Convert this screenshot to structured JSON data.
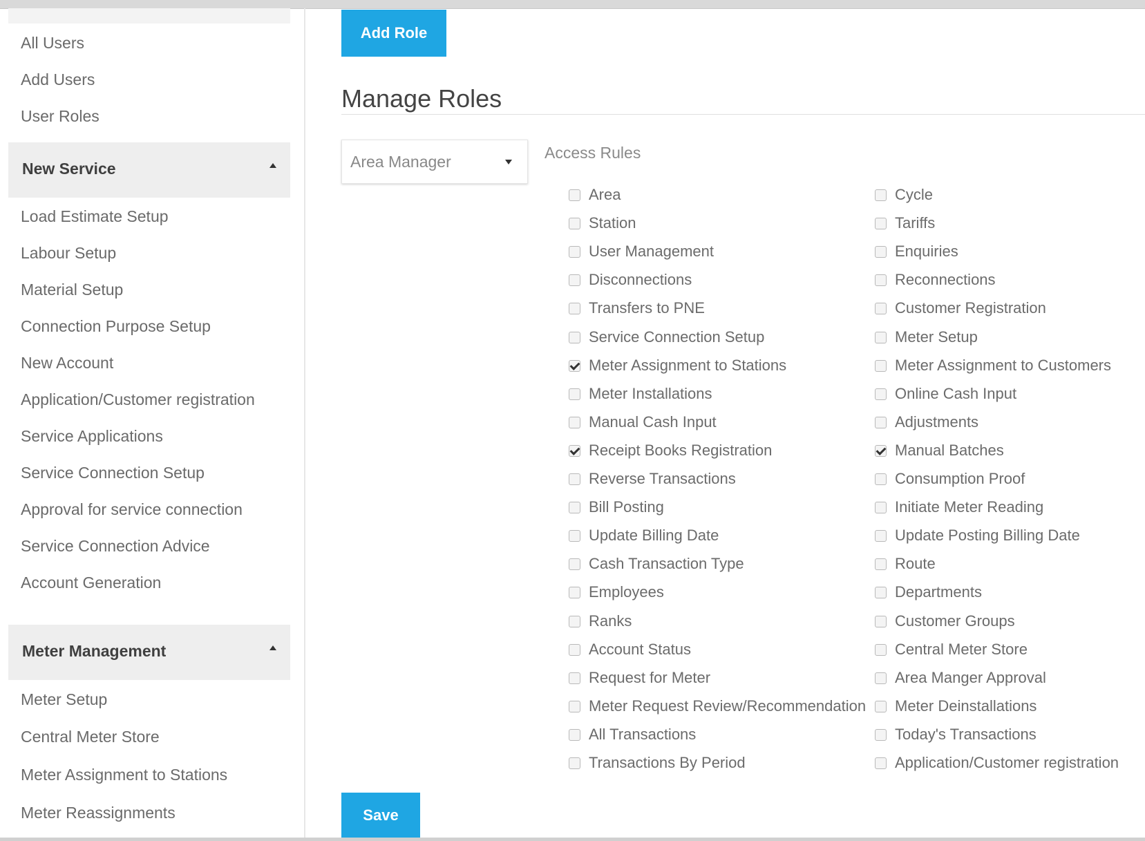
{
  "sidebar": {
    "top_items": [
      "All Users",
      "Add Users",
      "User Roles"
    ],
    "sections": [
      {
        "title": "New Service",
        "items": [
          "Load Estimate Setup",
          "Labour Setup",
          "Material Setup",
          "Connection Purpose Setup",
          "New Account",
          "Application/Customer registration",
          "Service Applications",
          "Service Connection Setup",
          "Approval for service connection",
          "Service Connection Advice",
          "Account Generation"
        ]
      },
      {
        "title": "Meter Management",
        "items": [
          "Meter Setup",
          "Central Meter Store",
          "Meter Assignment to Stations",
          "Meter Reassignments"
        ]
      }
    ]
  },
  "main": {
    "add_role_label": "Add Role",
    "title": "Manage Roles",
    "role_select": {
      "selected": "Area Manager"
    },
    "access_rules_label": "Access Rules",
    "save_label": "Save",
    "rules_left": [
      {
        "label": "Area",
        "checked": false
      },
      {
        "label": "Station",
        "checked": false
      },
      {
        "label": "User Management",
        "checked": false
      },
      {
        "label": "Disconnections",
        "checked": false
      },
      {
        "label": "Transfers to PNE",
        "checked": false
      },
      {
        "label": "Service Connection Setup",
        "checked": false
      },
      {
        "label": "Meter Assignment to Stations",
        "checked": true
      },
      {
        "label": "Meter Installations",
        "checked": false
      },
      {
        "label": "Manual Cash Input",
        "checked": false
      },
      {
        "label": "Receipt Books Registration",
        "checked": true
      },
      {
        "label": "Reverse Transactions",
        "checked": false
      },
      {
        "label": "Bill Posting",
        "checked": false
      },
      {
        "label": "Update Billing Date",
        "checked": false
      },
      {
        "label": "Cash Transaction Type",
        "checked": false
      },
      {
        "label": "Employees",
        "checked": false
      },
      {
        "label": "Ranks",
        "checked": false
      },
      {
        "label": "Account Status",
        "checked": false
      },
      {
        "label": "Request for Meter",
        "checked": false
      },
      {
        "label": "Meter Request Review/Recommendation",
        "checked": false
      },
      {
        "label": "All Transactions",
        "checked": false
      },
      {
        "label": "Transactions By Period",
        "checked": false
      }
    ],
    "rules_right": [
      {
        "label": "Cycle",
        "checked": false
      },
      {
        "label": "Tariffs",
        "checked": false
      },
      {
        "label": "Enquiries",
        "checked": false
      },
      {
        "label": "Reconnections",
        "checked": false
      },
      {
        "label": "Customer Registration",
        "checked": false
      },
      {
        "label": "Meter Setup",
        "checked": false
      },
      {
        "label": "Meter Assignment to Customers",
        "checked": false
      },
      {
        "label": "Online Cash Input",
        "checked": false
      },
      {
        "label": "Adjustments",
        "checked": false
      },
      {
        "label": "Manual Batches",
        "checked": true
      },
      {
        "label": "Consumption Proof",
        "checked": false
      },
      {
        "label": "Initiate Meter Reading",
        "checked": false
      },
      {
        "label": "Update Posting Billing Date",
        "checked": false
      },
      {
        "label": "Route",
        "checked": false
      },
      {
        "label": "Departments",
        "checked": false
      },
      {
        "label": "Customer Groups",
        "checked": false
      },
      {
        "label": "Central Meter Store",
        "checked": false
      },
      {
        "label": "Area Manger Approval",
        "checked": false
      },
      {
        "label": "Meter Deinstallations",
        "checked": false
      },
      {
        "label": "Today's Transactions",
        "checked": false
      },
      {
        "label": "Application/Customer registration",
        "checked": false
      }
    ]
  }
}
